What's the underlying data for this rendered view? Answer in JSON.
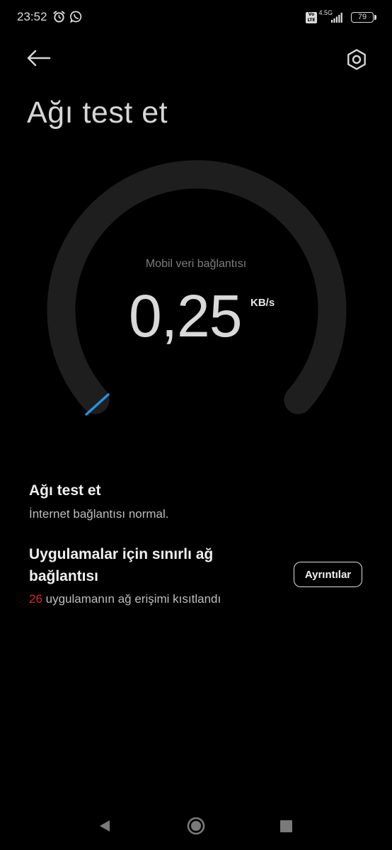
{
  "status_bar": {
    "time": "23:52",
    "network_type": "4.5G",
    "volte_top": "Vo",
    "volte_bottom": "LTE",
    "battery": "79"
  },
  "toolbar": {
    "back_icon": "arrow-left-icon",
    "settings_icon": "gear-icon"
  },
  "page": {
    "title": "Ağı test et"
  },
  "gauge": {
    "label": "Mobil veri bağlantısı",
    "value": "0,25",
    "unit": "KB/s",
    "track_color": "#1e1e1e",
    "needle_color": "#2b8fe0"
  },
  "network_test": {
    "title": "Ağı test et",
    "status": "İnternet bağlantısı normal."
  },
  "restricted_apps": {
    "title_line1": "Uygulamalar için sınırlı ağ",
    "title_line2": "bağlantısı",
    "count": "26",
    "suffix": " uygulamanın ağ erişimi kısıtlandı",
    "count_color": "#d02b2b",
    "details_label": "Ayrıntılar"
  },
  "nav_bar": {
    "back_icon": "triangle-back-icon",
    "home_icon": "circle-home-icon",
    "recents_icon": "square-recents-icon"
  }
}
